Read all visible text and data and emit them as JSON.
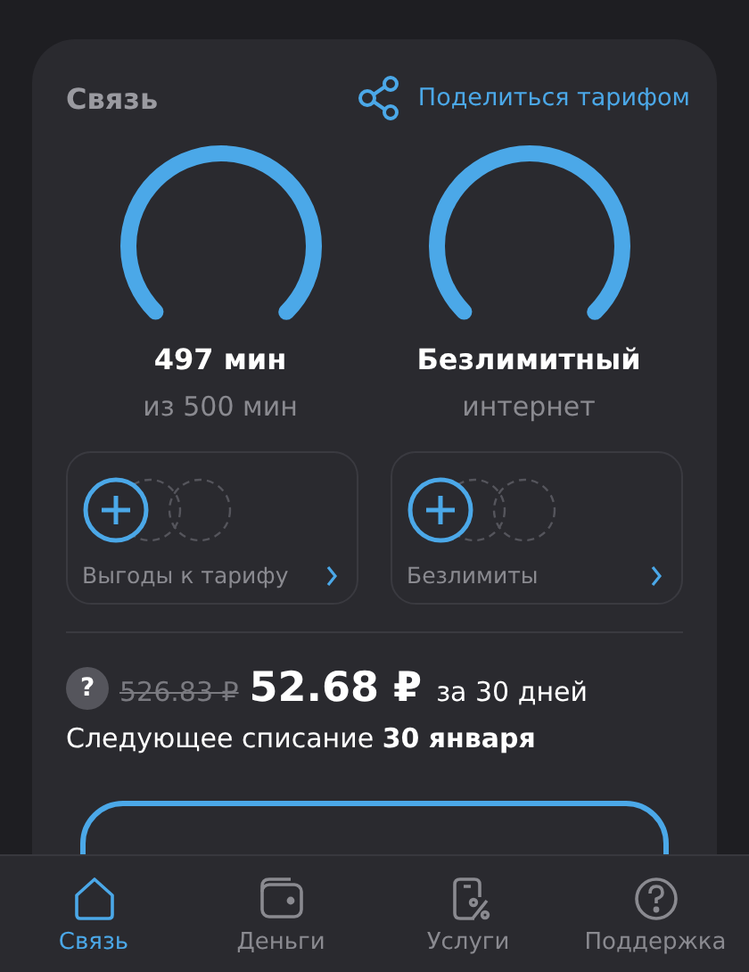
{
  "card": {
    "title": "Связь",
    "share_link": "Поделиться тарифом"
  },
  "gauges": [
    {
      "value": "497 мин",
      "caption": "из 500 мин"
    },
    {
      "value": "Безлимитный",
      "caption": "интернет"
    }
  ],
  "tiles": [
    {
      "label": "Выгоды к тарифу"
    },
    {
      "label": "Безлимиты"
    }
  ],
  "price": {
    "help": "?",
    "old": "526.83 ₽",
    "current": "52.68 ₽",
    "period": "за 30 дней",
    "next_charge": "Следующее списание **30 января**"
  },
  "nav": [
    {
      "label": "Связь",
      "kind": "home",
      "selected": true
    },
    {
      "label": "Деньги",
      "kind": "wallet",
      "selected": false
    },
    {
      "label": "Услуги",
      "kind": "services",
      "selected": false
    },
    {
      "label": "Поддержка",
      "kind": "support",
      "selected": false
    }
  ]
}
